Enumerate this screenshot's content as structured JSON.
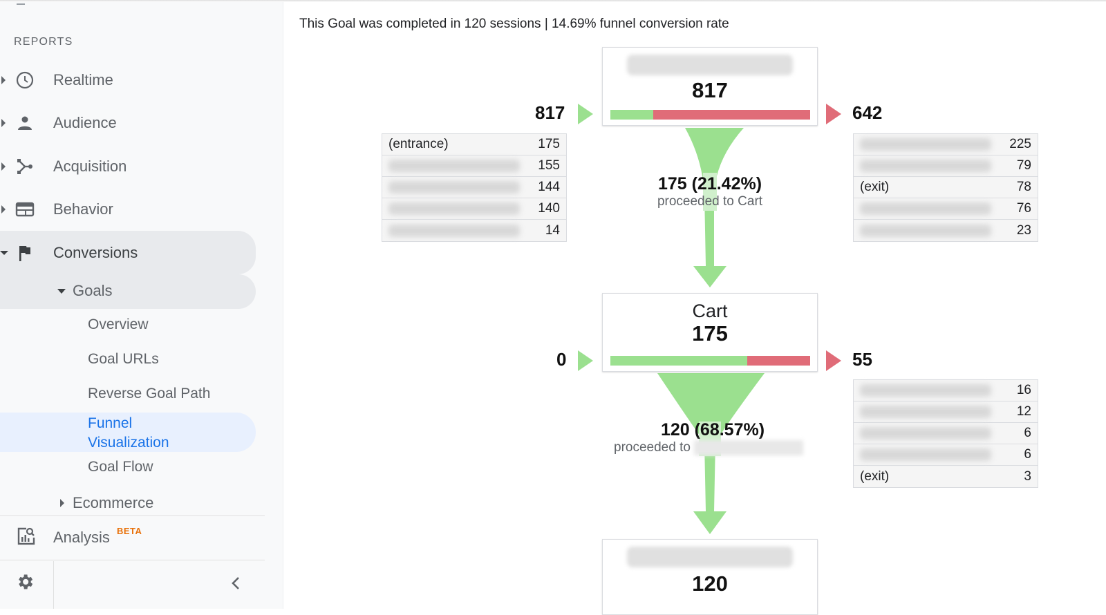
{
  "sidebar": {
    "section_label": "REPORTS",
    "items": [
      {
        "label": "Realtime",
        "icon": "clock-icon"
      },
      {
        "label": "Audience",
        "icon": "person-icon"
      },
      {
        "label": "Acquisition",
        "icon": "acquisition-icon"
      },
      {
        "label": "Behavior",
        "icon": "behavior-icon"
      },
      {
        "label": "Conversions",
        "icon": "flag-icon"
      }
    ],
    "goals": {
      "label": "Goals",
      "children": [
        "Overview",
        "Goal URLs",
        "Reverse Goal Path",
        "Funnel Visualization",
        "Goal Flow"
      ],
      "active": "Funnel Visualization"
    },
    "funnel_line1": "Funnel",
    "funnel_line2": "Visualization",
    "ecommerce": "Ecommerce",
    "analysis": {
      "label": "Analysis",
      "badge": "BETA"
    },
    "settings_icon": "gear-icon",
    "collapse_icon": "chevron-left-icon"
  },
  "main": {
    "summary": "This Goal was completed in 120 sessions | 14.69% funnel conversion rate",
    "stages": [
      {
        "name": "",
        "count": "817",
        "entries": "817",
        "exits": "642",
        "bar_fraction_proceeded": 0.2142,
        "entries_table": [
          {
            "label": "(entrance)",
            "value": "175"
          },
          {
            "label": "",
            "value": "155"
          },
          {
            "label": "",
            "value": "144"
          },
          {
            "label": "",
            "value": "140"
          },
          {
            "label": "",
            "value": "14"
          }
        ],
        "exits_table": [
          {
            "label": "",
            "value": "225"
          },
          {
            "label": "",
            "value": "79"
          },
          {
            "label": "(exit)",
            "value": "78"
          },
          {
            "label": "",
            "value": "76"
          },
          {
            "label": "",
            "value": "23"
          }
        ],
        "flow": {
          "value": "175 (21.42%)",
          "text": "proceeded to Cart"
        }
      },
      {
        "name": "Cart",
        "count": "175",
        "entries": "0",
        "exits": "55",
        "bar_fraction_proceeded": 0.6857,
        "exits_table": [
          {
            "label": "",
            "value": "16"
          },
          {
            "label": "",
            "value": "12"
          },
          {
            "label": "",
            "value": "6"
          },
          {
            "label": "",
            "value": "6"
          },
          {
            "label": "(exit)",
            "value": "3"
          }
        ],
        "flow": {
          "value": "120 (68.57%)",
          "text": "proceeded to"
        }
      },
      {
        "name": "",
        "count": "120"
      }
    ]
  },
  "colors": {
    "proceeded": "#9be08f",
    "dropoff": "#e06c78",
    "active_nav": "#1a73e8",
    "beta": "#e8710a"
  }
}
